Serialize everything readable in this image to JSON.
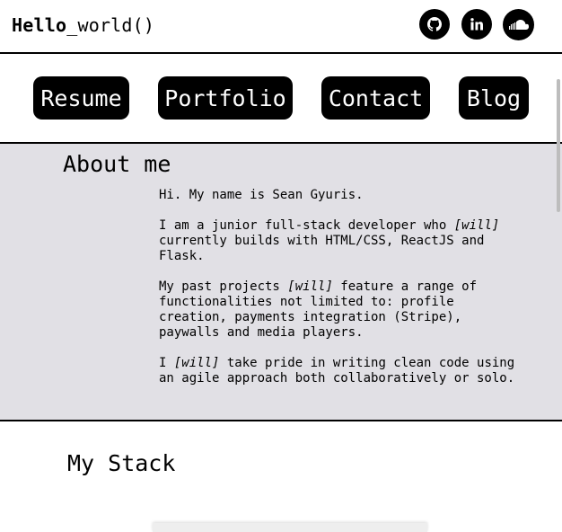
{
  "header": {
    "logo_bold": "Hello",
    "logo_rest": "_world()",
    "social": [
      "github-icon",
      "linkedin-icon",
      "soundcloud-icon"
    ]
  },
  "nav": {
    "items": [
      "Resume",
      "Portfolio",
      "Contact",
      "Blog"
    ]
  },
  "about": {
    "title": "About me",
    "p1": "Hi. My name is Sean Gyuris.",
    "p2_a": "I am a junior full-stack developer who ",
    "p2_em": "[will]",
    "p2_b": "\ncurrently builds with HTML/CSS, ReactJS and\nFlask.",
    "p3_a": "My past projects ",
    "p3_em": "[will]",
    "p3_b": " feature a range of\nfunctionalities not limited to: profile\ncreation, payments integration (Stripe),\npaywalls and media players.",
    "p4_a": "I ",
    "p4_em": "[will]",
    "p4_b": " take pride in writing clean code using\nan agile approach both collaboratively or solo."
  },
  "stack": {
    "title": "My Stack"
  },
  "colors": {
    "about_bg": "#e1e0e5",
    "button_bg": "#000000",
    "button_text": "#ffffff"
  }
}
